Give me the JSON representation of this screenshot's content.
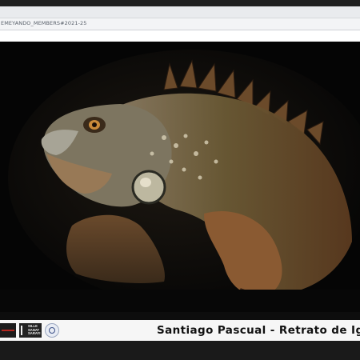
{
  "browser": {
    "tab_title": "EMEYANDO_MEMBERS#2021-25"
  },
  "photo": {
    "subject_icon": "iguana-photo"
  },
  "footer": {
    "credit_text": "Santiago Pascual - Retrato de Igu",
    "logos": [
      {
        "name": "red-mark-logo"
      },
      {
        "name": "sille-sanat-logo",
        "text": "SILLE\nSANAT\nSARAYI"
      },
      {
        "name": "municipal-seal-logo"
      }
    ]
  },
  "colors": {
    "chrome_bg": "#202020",
    "toolbar_bg": "#e9ebee",
    "tab_text": "#59606a",
    "stage_bg": "#060606",
    "footer_bg": "#f6f6f6",
    "credit_color": "#111111"
  }
}
